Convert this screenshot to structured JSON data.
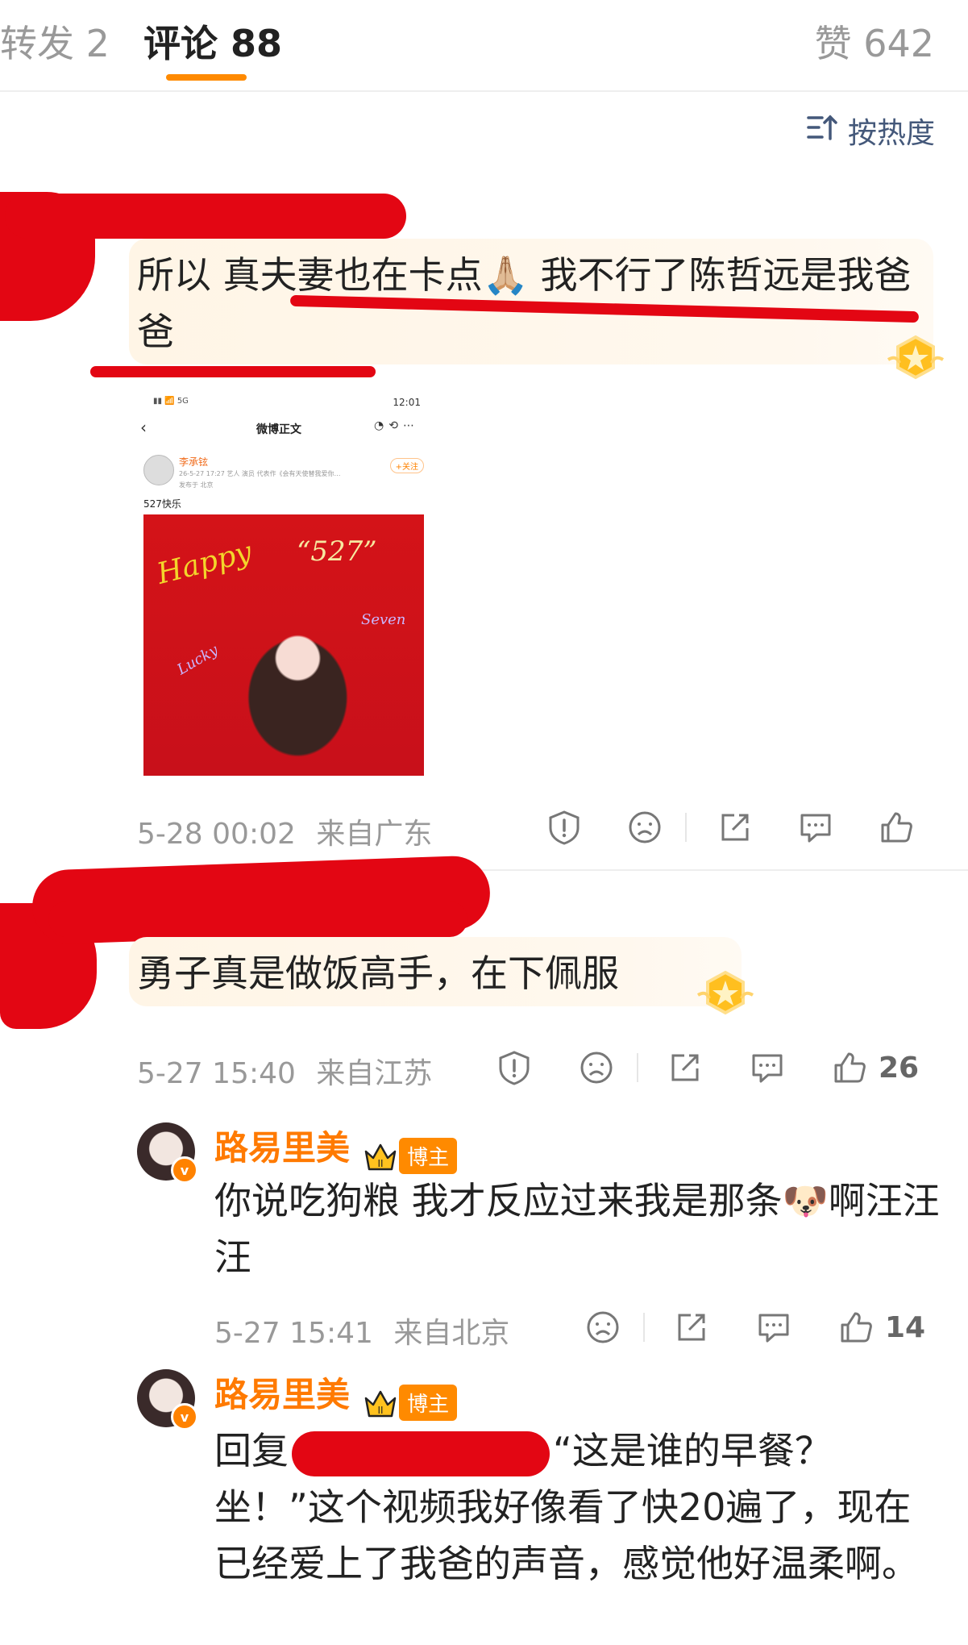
{
  "tabs": {
    "repost": "转发 2",
    "comments": "评论 88",
    "likes": "赞 642"
  },
  "sort": {
    "icon": "sort-icon",
    "label": "按热度"
  },
  "colors": {
    "accent": "#ff8a00",
    "username": "#ff7a00",
    "scribble": "#e30613"
  },
  "comments": [
    {
      "text": "所以 真夫妻也在卡点🙏🏼 我不行了陈哲远是我爸爸",
      "embed": {
        "status_time": "12:01",
        "nav_title": "微博正文",
        "poster_name": "李承铉",
        "poster_meta": "26-5-27 17:27  艺人 演员 代表作《会有天使替我爱你…",
        "poster_location": "发布于 北京",
        "follow_label": "+关注",
        "post_text": "527快乐",
        "photo_text_1": "Happy",
        "photo_text_2": "“527”",
        "photo_text_3": "Lucky",
        "photo_text_4": "Seven"
      },
      "time": "5-28 00:02",
      "location": "来自广东",
      "like_count": ""
    },
    {
      "text": "勇子真是做饭高手，在下佩服",
      "time": "5-27 15:40",
      "location": "来自江苏",
      "like_count": "26",
      "replies": [
        {
          "username": "路易里美",
          "badge": "博主",
          "text": "你说吃狗粮 我才反应过来我是那条🐶啊汪汪汪",
          "time": "5-27 15:41",
          "location": "来自北京",
          "like_count": "14"
        },
        {
          "username": "路易里美",
          "badge": "博主",
          "reply_prefix": "回复",
          "text": "“这是谁的早餐？坐！”这个视频我好像看了快20遍了，现在已经爱上了我爸的声音，感觉他好温柔啊。"
        }
      ]
    }
  ]
}
